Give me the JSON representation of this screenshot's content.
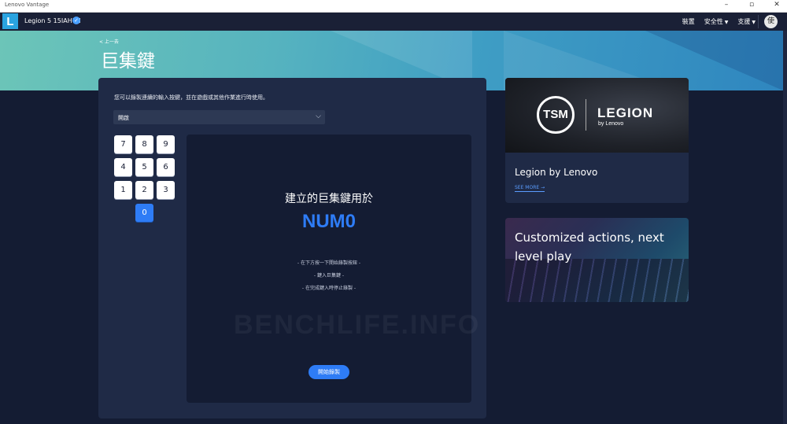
{
  "window": {
    "title": "Lenovo Vantage",
    "controls": [
      "–",
      "▫",
      "✕"
    ]
  },
  "header": {
    "device_name": "Legion 5 15IAH7H",
    "nav": [
      {
        "label": "裝置",
        "has_caret": false
      },
      {
        "label": "安全性",
        "has_caret": true
      },
      {
        "label": "支援",
        "has_caret": true
      }
    ],
    "avatar_initial": "使"
  },
  "banner": {
    "back_label": "< 上一去",
    "title": "巨集鍵"
  },
  "macro": {
    "description": "您可以錄製連續的輸入按鍵，並在遊戲或其他作業進行時使用。",
    "mode_select": {
      "value": "開啟"
    },
    "keypad": {
      "rows": [
        [
          "7",
          "8",
          "9"
        ],
        [
          "4",
          "5",
          "6"
        ],
        [
          "1",
          "2",
          "3"
        ]
      ],
      "zero": "0",
      "active_key": "0"
    },
    "record": {
      "title": "建立的巨集鍵用於",
      "key_name": "NUM0",
      "steps": [
        "- 在下方按一下開始錄製按鈕 -",
        "- 鍵入巨集鍵 -",
        "- 在完成鍵入時停止錄製 -"
      ],
      "watermark": "BENCHLIFE.INFO",
      "start_button": "開始錄製"
    }
  },
  "cards": {
    "legion": {
      "image_logo_text": "LEGION",
      "image_logo_sub": "by Lenovo",
      "image_badge": "TSM",
      "title": "Legion by Lenovo",
      "see_more": "SEE MORE →"
    },
    "customized": {
      "title": "Customized actions, next level play"
    }
  },
  "colors": {
    "accent": "#2e7cf6",
    "card_bg": "#1f2a46",
    "page_bg": "#141c33",
    "logo": "#2aa3e0"
  }
}
